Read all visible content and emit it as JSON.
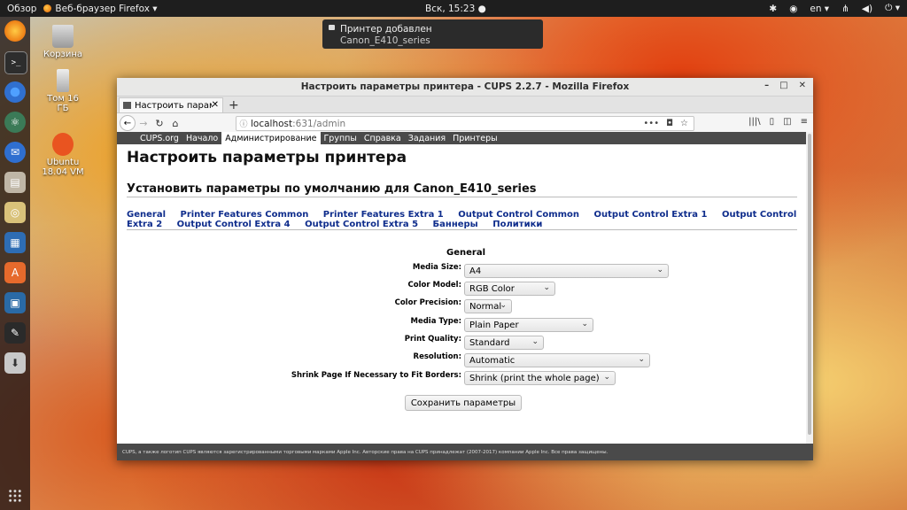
{
  "topbar": {
    "overview": "Обзор",
    "app_name": "Веб-браузер Firefox ▾",
    "clock": "Вск, 15:23 ●",
    "lang": "en ▾",
    "tray_icons": [
      "accessibility-icon",
      "network-icon",
      "lang-indicator",
      "network-tray-icon",
      "volume-icon",
      "power-icon"
    ]
  },
  "dock": {
    "items": [
      "firefox",
      "terminal",
      "chromium",
      "atom",
      "thunderbird",
      "file-manager",
      "rhythmbox",
      "libreoffice-writer",
      "software-center",
      "virtualbox",
      "inkscape",
      "installer"
    ]
  },
  "desktop": {
    "trash_label": "Корзина",
    "volume_label_1": "Том 16",
    "volume_label_2": "ГБ",
    "ubuntu_label_1": "Ubuntu",
    "ubuntu_label_2": "18.04 VM"
  },
  "notification": {
    "title": "Принтер добавлен",
    "body": "Canon_E410_series"
  },
  "window": {
    "title": "Настроить параметры принтера - CUPS 2.2.7 - Mozilla Firefox",
    "tab_label": "Настроить парамe",
    "url_host": "localhost",
    "url_path": ":631/admin"
  },
  "cups": {
    "nav": [
      "CUPS.org",
      "Начало",
      "Администрирование",
      "Группы",
      "Справка",
      "Задания",
      "Принтеры"
    ],
    "active_nav": "Администрирование",
    "page_title": "Настроить параметры принтера",
    "subtitle": "Установить параметры по умолчанию для Canon_E410_series",
    "links": [
      "General",
      "Printer Features Common",
      "Printer Features Extra 1",
      "Output Control Common",
      "Output Control Extra 1",
      "Output Control Extra 2",
      "Output Control Extra 4",
      "Output Control Extra 5",
      "Баннеры",
      "Политики"
    ],
    "section": "General",
    "fields": [
      {
        "label": "Media Size:",
        "value": "A4"
      },
      {
        "label": "Color Model:",
        "value": "RGB Color"
      },
      {
        "label": "Color Precision:",
        "value": "Normal"
      },
      {
        "label": "Media Type:",
        "value": "Plain Paper"
      },
      {
        "label": "Print Quality:",
        "value": "Standard"
      },
      {
        "label": "Resolution:",
        "value": "Automatic"
      },
      {
        "label": "Shrink Page If Necessary to Fit Borders:",
        "value": "Shrink (print the whole page)"
      }
    ],
    "save_label": "Сохранить параметры",
    "footer": "CUPS, а также логотип CUPS являются зарегистрированными торговыми марками Apple Inc. Авторские права на CUPS принадлежат (2007-2017) компании Apple Inc. Все права защищены."
  },
  "colors": {
    "link": "#0f2d8c",
    "cups_nav_bg": "#4a4a4a",
    "topbar_bg": "#1e1e1e"
  }
}
